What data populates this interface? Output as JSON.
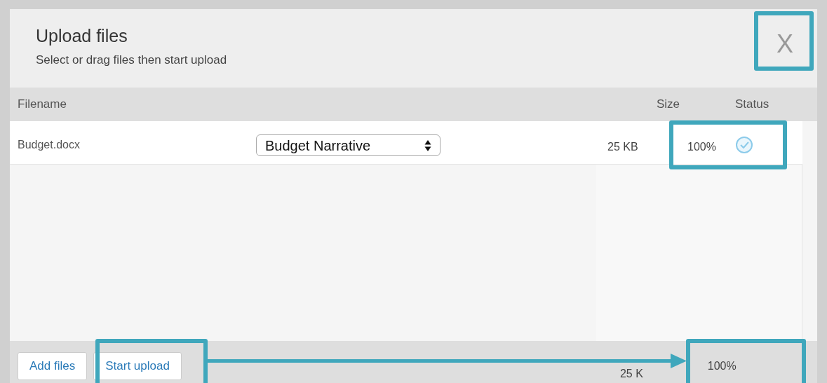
{
  "dialog": {
    "title": "Upload files",
    "subtitle": "Select or drag files then start upload",
    "close": "X"
  },
  "table": {
    "columns": [
      "Filename",
      "Size",
      "Status"
    ],
    "rows": [
      {
        "filename": "Budget.docx",
        "category": "Budget Narrative",
        "size": "25 KB",
        "progress": "100%",
        "done": true
      }
    ]
  },
  "footer": {
    "buttons": [
      "Add files",
      "Start upload"
    ],
    "total_size": "25 K",
    "total_progress": "100%"
  }
}
